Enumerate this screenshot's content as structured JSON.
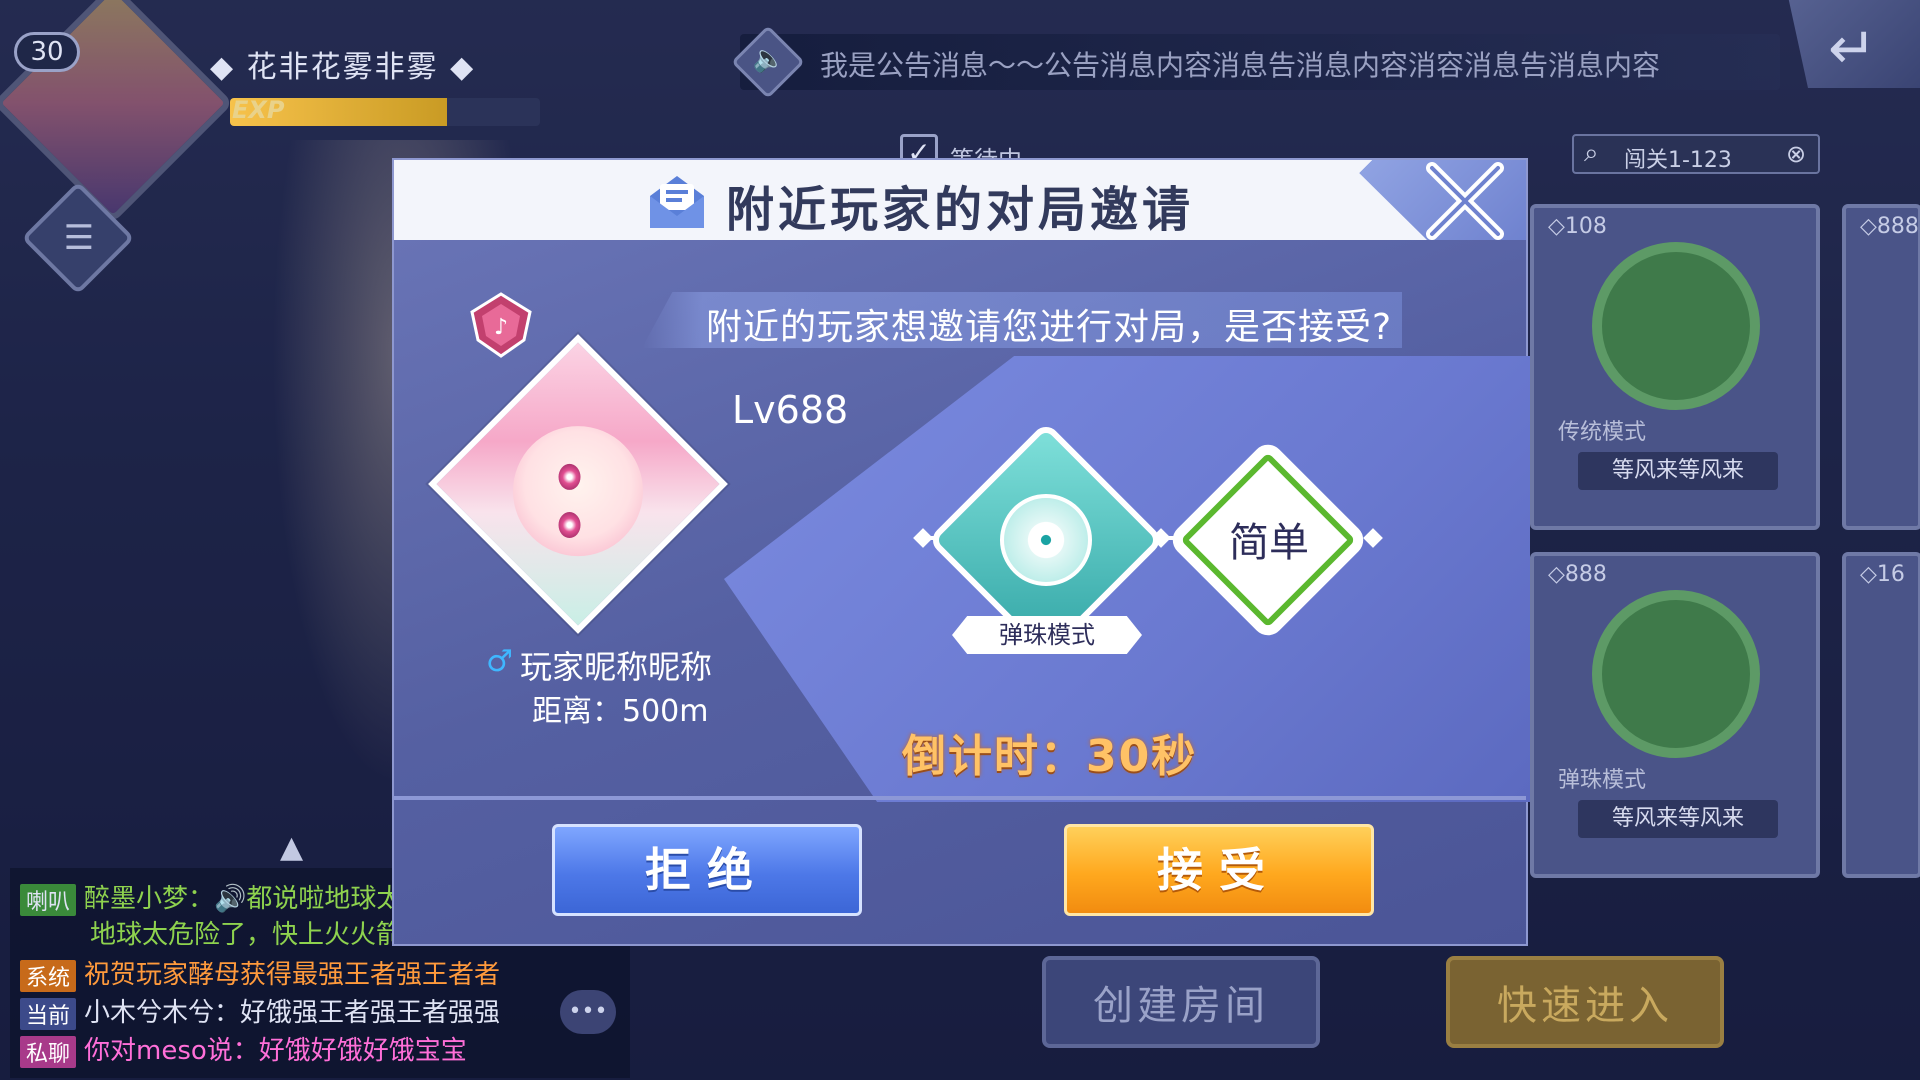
{
  "hud": {
    "player_level": "30",
    "player_name": "花非花雾非雾",
    "exp_label": "EXP",
    "exp_progress": 0.7,
    "announcement": "我是公告消息～～公告消息内容消息告消息内容消容消息告消息内容",
    "filter_label": "等待中",
    "search_value": "闯关1-123"
  },
  "rooms": [
    {
      "id": "108",
      "mode": "传统模式",
      "name": "等风来等风来"
    },
    {
      "id": "888",
      "mode": "弹珠模式",
      "name": "等风来等风来"
    },
    {
      "id": "888",
      "mode": "",
      "name": ""
    },
    {
      "id": "16",
      "mode": "",
      "name": ""
    }
  ],
  "bottom_buttons": {
    "create_room": "创建房间",
    "quick_join": "快速进入"
  },
  "chat": [
    {
      "channel": "喇叭",
      "text": "醉墨小梦：🔊都说啦地球太危险了…",
      "channel_color": "#3a8a3a",
      "text_color": "#8ed24e"
    },
    {
      "channel": "",
      "text": "地球太危险了，快上火火箭…",
      "channel_color": "",
      "text_color": "#8ed24e"
    },
    {
      "channel": "系统",
      "text": "祝贺玩家酵母获得最强王者强王者者",
      "channel_color": "#c76a1a",
      "text_color": "#ff9a3c"
    },
    {
      "channel": "当前",
      "text": "小木兮木兮：好饿强王者强王者强强",
      "channel_color": "#3c4a8a",
      "text_color": "#dfe3f4"
    },
    {
      "channel": "私聊",
      "text": "你对meso说：好饿好饿好饿宝宝",
      "channel_color": "#a83a8a",
      "text_color": "#ff6fd8"
    }
  ],
  "modal": {
    "title": "附近玩家的对局邀请",
    "prompt": "附近的玩家想邀请您进行对局，是否接受?",
    "player": {
      "level": "Lv688",
      "nickname": "玩家昵称昵称",
      "distance": "距离：500m",
      "gender_icon": "male-icon"
    },
    "game_mode": "弹珠模式",
    "difficulty": "简单",
    "countdown": "倒计时：30秒",
    "reject_label": "拒绝",
    "accept_label": "接受"
  },
  "colors": {
    "accept": "#ffa81e",
    "reject": "#4d78e8",
    "countdown": "#ffc266",
    "difficulty_ring": "#5bb82f",
    "mode_teal": "#33a6a6"
  }
}
